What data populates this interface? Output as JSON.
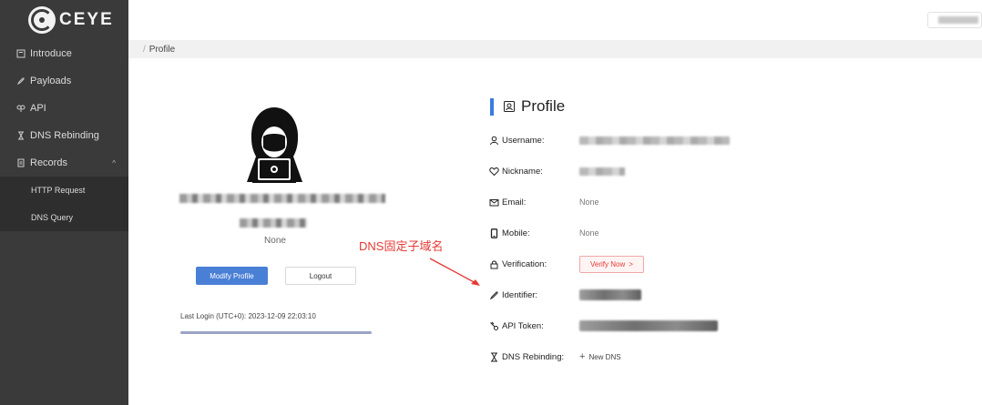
{
  "sidebar": {
    "logo_text": "CEYE",
    "items": [
      {
        "label": "Introduce",
        "icon": "book-icon"
      },
      {
        "label": "Payloads",
        "icon": "rocket-icon"
      },
      {
        "label": "API",
        "icon": "api-icon"
      },
      {
        "label": "DNS Rebinding",
        "icon": "hourglass-icon"
      },
      {
        "label": "Records",
        "icon": "records-icon"
      }
    ],
    "records_sub": [
      {
        "label": "HTTP Request"
      },
      {
        "label": "DNS Query"
      }
    ]
  },
  "breadcrumb": {
    "separator": "/",
    "current": "Profile"
  },
  "left_card": {
    "mobile": "None",
    "modify_label": "Modify Profile",
    "logout_label": "Logout",
    "last_login": "Last Login (UTC+0): 2023-12-09 22:03:10"
  },
  "annotation": {
    "text": "DNS固定子域名",
    "color": "#e53935"
  },
  "profile": {
    "title": "Profile",
    "rows": {
      "username": {
        "label": "Username:"
      },
      "nickname": {
        "label": "Nickname:"
      },
      "email": {
        "label": "Email:",
        "value": "None"
      },
      "mobile": {
        "label": "Mobile:",
        "value": "None"
      },
      "verification": {
        "label": "Verification:",
        "button": "Verify Now",
        "arrow": ">"
      },
      "identifier": {
        "label": "Identifier:"
      },
      "api_token": {
        "label": "API Token:"
      },
      "dns_rebinding": {
        "label": "DNS Rebinding:",
        "button": "New DNS",
        "plus": "+"
      }
    }
  },
  "colors": {
    "sidebar_bg": "#3a3a3a",
    "accent": "#3b7be0",
    "primary_button": "#4a7fd6",
    "danger": "#e53935"
  }
}
